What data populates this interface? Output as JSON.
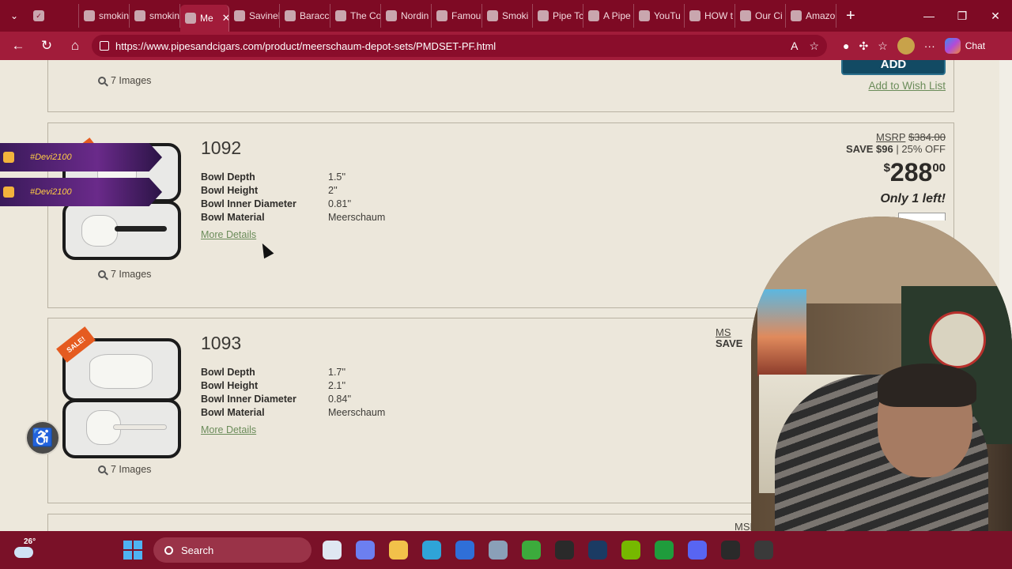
{
  "browser": {
    "tabs": [
      {
        "label": "",
        "fav": "✓"
      },
      {
        "label": "smokin",
        "fav": ""
      },
      {
        "label": "smokin",
        "fav": ""
      },
      {
        "label": "Me",
        "fav": "",
        "active": true
      },
      {
        "label": "Savinel",
        "fav": ""
      },
      {
        "label": "Baracc",
        "fav": ""
      },
      {
        "label": "The Co",
        "fav": ""
      },
      {
        "label": "Nordin",
        "fav": ""
      },
      {
        "label": "Famou",
        "fav": ""
      },
      {
        "label": "Smoki",
        "fav": ""
      },
      {
        "label": "Pipe Tc",
        "fav": ""
      },
      {
        "label": "A Pipe",
        "fav": ""
      },
      {
        "label": "YouTu",
        "fav": ""
      },
      {
        "label": "HOW t",
        "fav": ""
      },
      {
        "label": "Our Ci",
        "fav": ""
      },
      {
        "label": "Amazo",
        "fav": ""
      }
    ],
    "url": "https://www.pipesandcigars.com/product/meerschaum-depot-sets/PMDSET-PF.html",
    "chat_label": "Chat"
  },
  "products": {
    "prev": {
      "images": "7 Images",
      "add_label": "ADD",
      "wish_label": "Add to Wish List"
    },
    "p1092": {
      "sku": "1092",
      "specs": [
        {
          "k": "Bowl Depth",
          "v": "1.5''"
        },
        {
          "k": "Bowl Height",
          "v": "2''"
        },
        {
          "k": "Bowl Inner Diameter",
          "v": "0.81''"
        },
        {
          "k": "Bowl Material",
          "v": "Meerschaum"
        }
      ],
      "more": "More Details",
      "images": "7 Images",
      "msrp_label": "MSRP",
      "msrp_price": "$384.00",
      "save_amt": "SAVE $96",
      "save_pct": "| 25% OFF",
      "price_cur": "$",
      "price_main": "288",
      "price_cents": "00",
      "stock": "Only 1 left!"
    },
    "p1093": {
      "sku": "1093",
      "sale": "SALE!",
      "specs": [
        {
          "k": "Bowl Depth",
          "v": "1.7''"
        },
        {
          "k": "Bowl Height",
          "v": "2.1''"
        },
        {
          "k": "Bowl Inner Diameter",
          "v": "0.84''"
        },
        {
          "k": "Bowl Material",
          "v": "Meerschaum"
        }
      ],
      "more": "More Details",
      "images": "7 Images",
      "msrp_label": "MS",
      "save_amt": "SAVE"
    },
    "next": {
      "msrp_label": "MSR"
    }
  },
  "overlays": {
    "banner_text": "#Devi2100"
  },
  "taskbar": {
    "temp": "26°",
    "search": "Search",
    "apps": [
      "files",
      "copilot",
      "explorer",
      "edge",
      "outlook",
      "settings",
      "xbox",
      "epic",
      "steam",
      "nvidia",
      "gamepass",
      "discord",
      "obs",
      "speed"
    ]
  }
}
